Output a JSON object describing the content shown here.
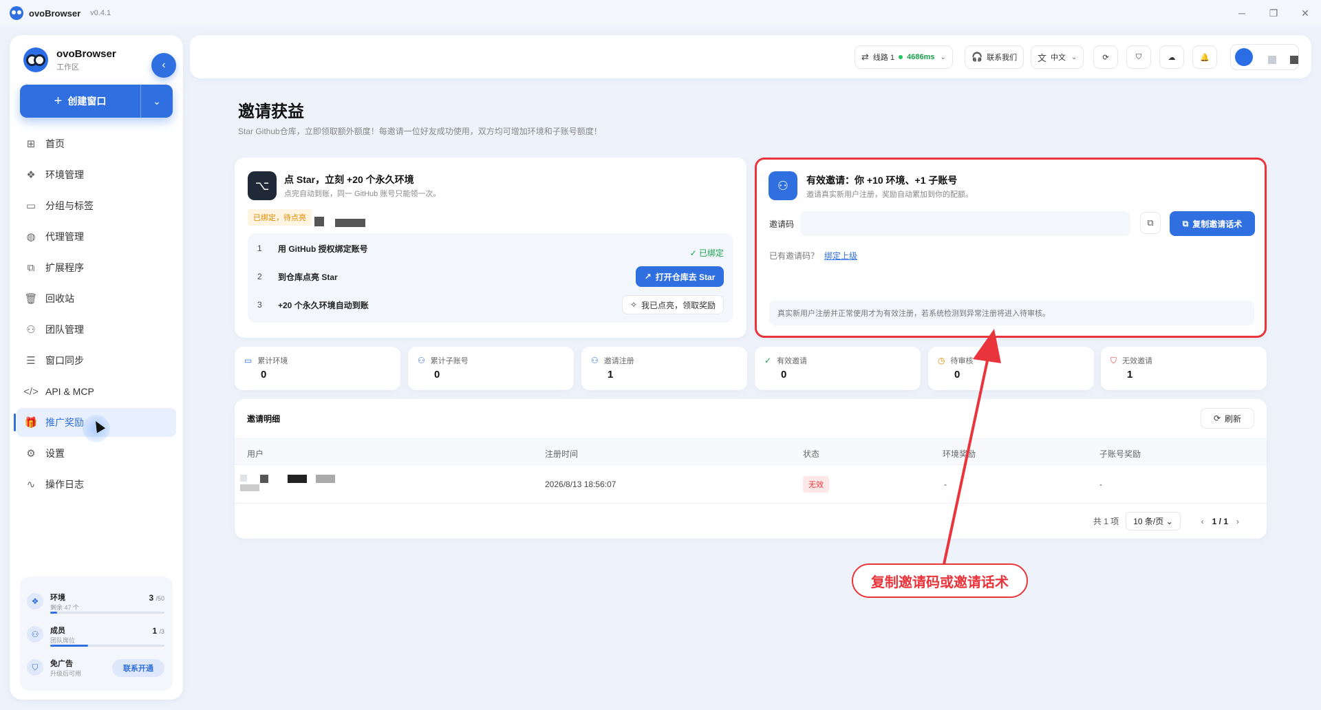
{
  "titlebar": {
    "app_name": "ovoBrowser",
    "version": "v0.4.1"
  },
  "sidebar": {
    "brand_name": "ovoBrowser",
    "brand_sub": "工作区",
    "create_label": "创建窗口",
    "items": [
      {
        "label": "首页",
        "icon": "home-icon"
      },
      {
        "label": "环境管理",
        "icon": "cubes-icon"
      },
      {
        "label": "分组与标签",
        "icon": "folder-tag-icon"
      },
      {
        "label": "代理管理",
        "icon": "globe-icon"
      },
      {
        "label": "扩展程序",
        "icon": "puzzle-icon"
      },
      {
        "label": "回收站",
        "icon": "trash-icon"
      },
      {
        "label": "团队管理",
        "icon": "users-icon"
      },
      {
        "label": "窗口同步",
        "icon": "sliders-icon"
      },
      {
        "label": "API & MCP",
        "icon": "code-icon"
      },
      {
        "label": "推广奖励",
        "icon": "gift-icon"
      },
      {
        "label": "设置",
        "icon": "gear-icon"
      },
      {
        "label": "操作日志",
        "icon": "activity-icon"
      }
    ],
    "active_item": "推广奖励",
    "quota": {
      "env": {
        "title": "环境",
        "sub": "剩余 47 个",
        "used": "3",
        "total": "/50",
        "fraction": 0.06
      },
      "member": {
        "title": "成员",
        "sub": "团队席位",
        "used": "1",
        "total": "/3",
        "fraction": 0.33
      },
      "ad": {
        "title": "免广告",
        "sub": "升级后可用",
        "button": "联系开通"
      }
    }
  },
  "topbar": {
    "line": {
      "label": "线路 1",
      "latency": "4686ms"
    },
    "contact": "联系我们",
    "language": "中文"
  },
  "page": {
    "title": "邀请获益",
    "subtitle": "Star Github仓库，立即领取额外额度！每邀请一位好友成功使用，双方均可增加环境和子账号额度！"
  },
  "github_card": {
    "title": "点 Star，立刻 +20 个永久环境",
    "sub": "点完自动到账，同一 GitHub 账号只能领一次。",
    "badge": "已绑定，待点亮",
    "steps": [
      {
        "num": "1",
        "text": "用 GitHub 授权绑定账号"
      },
      {
        "num": "2",
        "text": "到仓库点亮 Star"
      },
      {
        "num": "3",
        "text": "+20 个永久环境自动到账"
      }
    ],
    "step1_status": "已绑定",
    "open_repo_button": "打开仓库去 Star",
    "claim_button": "我已点亮，领取奖励"
  },
  "invite_card": {
    "title": "有效邀请：你 +10 环境、+1 子账号",
    "sub": "邀请真实新用户注册，奖励自动累加到你的配额。",
    "code_label": "邀请码",
    "copy_script_button": "复制邀请话术",
    "has_code_text": "已有邀请码？",
    "bind_link": "绑定上级",
    "notice": "真实新用户注册并正常使用才为有效注册，若系统检测到异常注册将进入待审核。"
  },
  "stats": [
    {
      "label": "累计环境",
      "value": "0",
      "icon": "monitor-icon",
      "color": "#2f6fe0"
    },
    {
      "label": "累计子账号",
      "value": "0",
      "icon": "user-plus-icon",
      "color": "#2f6fe0"
    },
    {
      "label": "邀请注册",
      "value": "1",
      "icon": "users-icon",
      "color": "#2f6fe0"
    },
    {
      "label": "有效邀请",
      "value": "0",
      "icon": "check-circle-icon",
      "color": "#16a34a"
    },
    {
      "label": "待审核",
      "value": "0",
      "icon": "clock-icon",
      "color": "#e08a00"
    },
    {
      "label": "无效邀请",
      "value": "1",
      "icon": "shield-x-icon",
      "color": "#e8343a"
    }
  ],
  "table": {
    "title": "邀请明细",
    "refresh": "刷新",
    "columns": [
      "用户",
      "注册时间",
      "状态",
      "环境奖励",
      "子账号奖励"
    ],
    "rows": [
      {
        "time": "2026/8/13 18:56:07",
        "status": "无效",
        "env_reward": "-",
        "sub_reward": "-"
      }
    ],
    "total": "共 1 项",
    "page_size": "10 条/页",
    "page": "1 / 1"
  },
  "annotation": {
    "label": "复制邀请码或邀请话术",
    "color": "#e8343a"
  }
}
